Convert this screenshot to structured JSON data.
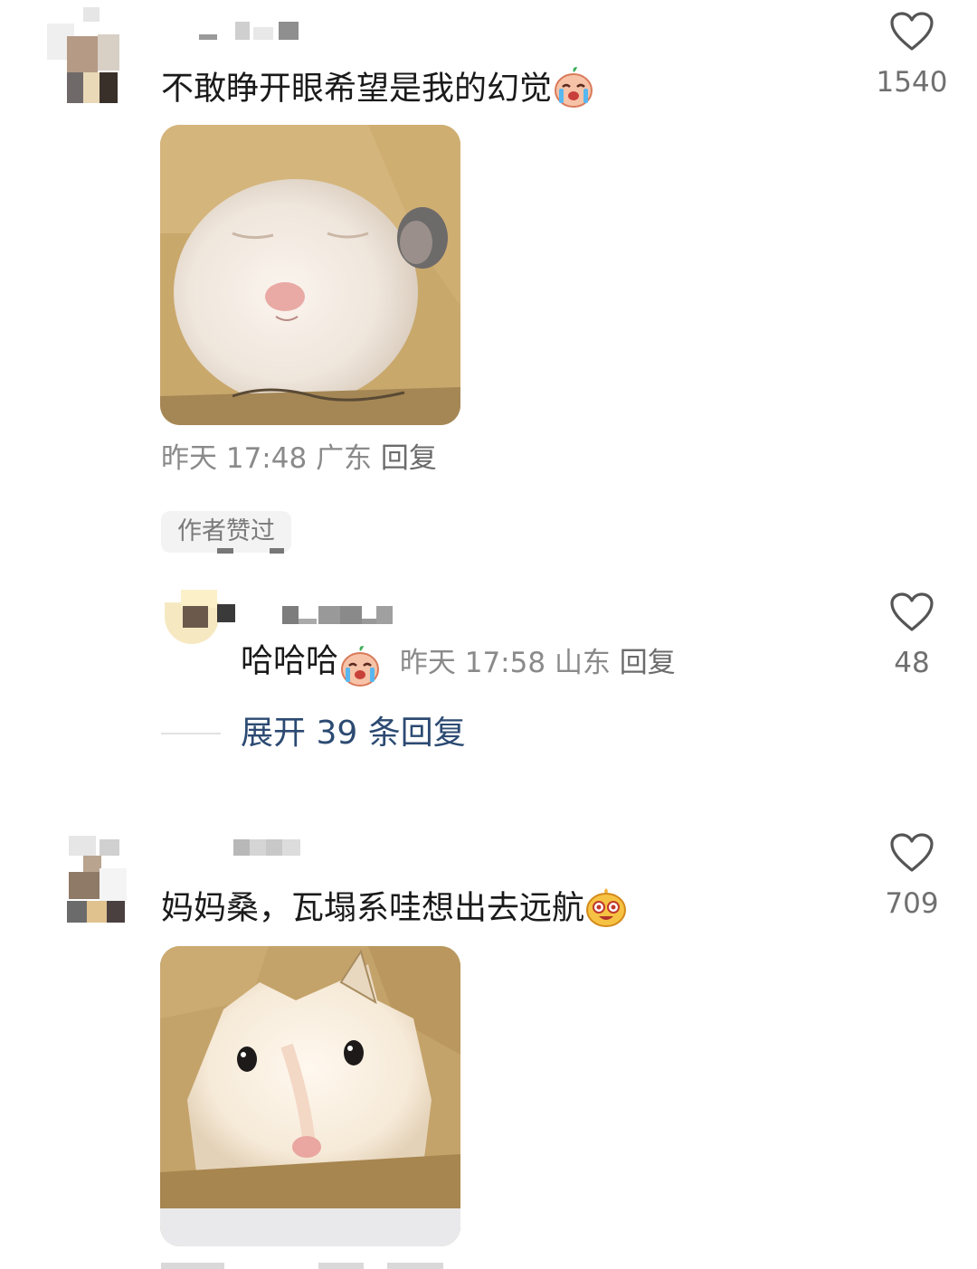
{
  "comments": [
    {
      "text": "不敢睁开眼希望是我的幻觉",
      "emoji_icon": "crying-face-icon",
      "likes": "1540",
      "time": "昨天 17:48",
      "location": "广东",
      "reply_label": "回复",
      "author_badge": "作者赞过",
      "image_desc": "hamster-squinting-photo"
    },
    {
      "text": "妈妈桑，瓦塌系哇想出去远航",
      "emoji_icon": "excited-face-icon",
      "likes": "709",
      "image_desc": "hamster-peeking-photo"
    }
  ],
  "reply": {
    "text": "哈哈哈",
    "emoji_icon": "crying-face-icon",
    "time": "昨天 17:58",
    "location": "山东",
    "reply_label": "回复",
    "likes": "48"
  },
  "expand": {
    "label": "展开 39 条回复"
  },
  "colors": {
    "expand_link": "#2c4a72",
    "meta_gray": "#8a8a8a",
    "photo_background": "#c9a86c"
  }
}
